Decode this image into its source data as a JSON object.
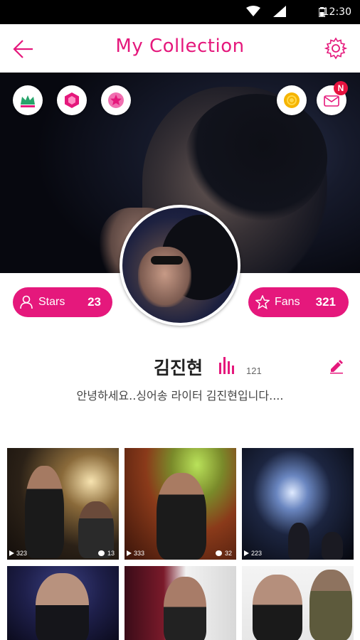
{
  "status_bar": {
    "time": "12:30"
  },
  "header": {
    "title": "My Collection"
  },
  "badges": {
    "notification_count": "N"
  },
  "stars": {
    "label": "Stars",
    "count": "23"
  },
  "fans": {
    "label": "Fans",
    "count": "321"
  },
  "profile": {
    "name": "김진현",
    "count": "121",
    "bio": "안녕하세요..싱어송 라이터 김진현입니다...."
  },
  "grid": [
    {
      "plays": "323",
      "comments": "13"
    },
    {
      "plays": "333",
      "comments": "32"
    },
    {
      "plays": "223",
      "comments": ""
    }
  ],
  "colors": {
    "accent": "#e5187c",
    "status_bar": "#000000"
  }
}
